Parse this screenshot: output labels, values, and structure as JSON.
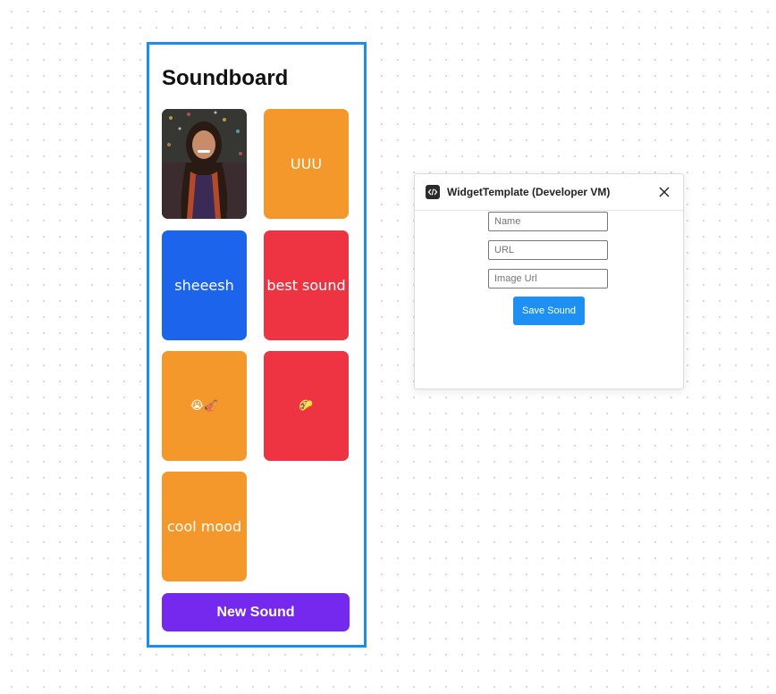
{
  "colors": {
    "widget_border": "#1a8ef0",
    "orange": "#f5982b",
    "blue": "#1c64ec",
    "red": "#ee3442",
    "purple": "#7528ee",
    "save_button": "#1e90f4"
  },
  "widget": {
    "title": "Soundboard",
    "tiles": [
      {
        "label": "",
        "kind": "image",
        "color": "#3a2a2a"
      },
      {
        "label": "UUU",
        "kind": "text",
        "color": "#f5982b"
      },
      {
        "label": "sheeesh",
        "kind": "text",
        "color": "#1c64ec"
      },
      {
        "label": "best sound",
        "kind": "text",
        "color": "#ee3442"
      },
      {
        "label": "😭🎻",
        "kind": "emoji",
        "color": "#f5982b"
      },
      {
        "label": "🌮",
        "kind": "emoji",
        "color": "#ee3442"
      },
      {
        "label": "cool mood",
        "kind": "text",
        "color": "#f5982b"
      }
    ],
    "new_sound_label": "New Sound"
  },
  "dialog": {
    "icon": "code-icon",
    "title": "WidgetTemplate (Developer VM)",
    "close_icon": "close-icon",
    "fields": {
      "name_placeholder": "Name",
      "url_placeholder": "URL",
      "image_url_placeholder": "Image Url"
    },
    "save_label": "Save Sound"
  }
}
